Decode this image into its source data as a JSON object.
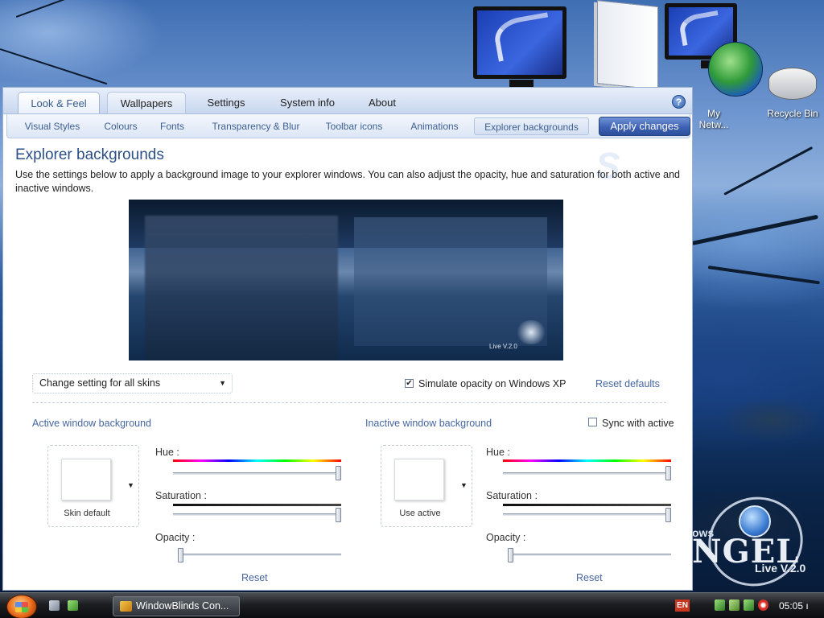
{
  "desktop": {
    "icons": [
      {
        "label": ""
      },
      {
        "label": ""
      },
      {
        "label": "My Netw..."
      },
      {
        "label": "Recycle Bin"
      }
    ],
    "brand": {
      "line1": "ows",
      "line2": "NGEL",
      "version": "Live V.2.0"
    }
  },
  "window": {
    "tabs": [
      {
        "label": "Look & Feel",
        "active": true
      },
      {
        "label": "Wallpapers",
        "active": false
      },
      {
        "label": "Settings",
        "active": false
      },
      {
        "label": "System info",
        "active": false
      },
      {
        "label": "About",
        "active": false
      }
    ],
    "help_label": "?",
    "subtabs": [
      {
        "label": "Visual Styles"
      },
      {
        "label": "Colours"
      },
      {
        "label": "Fonts"
      },
      {
        "label": "Transparency & Blur"
      },
      {
        "label": "Toolbar icons"
      },
      {
        "label": "Animations"
      },
      {
        "label": "Explorer backgrounds",
        "active": true
      }
    ],
    "apply_label": "Apply changes",
    "page_title": "Explorer backgrounds",
    "description": "Use the settings below to apply a background image to your explorer windows.  You can also adjust the opacity, hue and saturation for both active and inactive windows.",
    "preview_version": "Live V.2.0",
    "skin_select": {
      "value": "Change setting for all skins"
    },
    "simulate_opacity": {
      "label": "Simulate opacity on Windows XP",
      "checked": true,
      "mark": "✔"
    },
    "reset_defaults": "Reset defaults",
    "active": {
      "section_label": "Active window background",
      "swatch_caption": "Skin default",
      "hue_label": "Hue :",
      "saturation_label": "Saturation :",
      "opacity_label": "Opacity :",
      "hue": 1.0,
      "saturation": 1.0,
      "opacity": 0.0,
      "reset": "Reset"
    },
    "inactive": {
      "section_label": "Inactive window background",
      "sync_label": "Sync with active",
      "sync_checked": false,
      "swatch_caption": "Use active",
      "hue_label": "Hue :",
      "saturation_label": "Saturation :",
      "opacity_label": "Opacity :",
      "hue": 1.0,
      "saturation": 1.0,
      "opacity": 0.0,
      "reset": "Reset"
    }
  },
  "taskbar": {
    "task_label": "WindowBlinds Con...",
    "language": "EN",
    "clock": "05:05 ı"
  },
  "colors": {
    "accent": "#4566a0",
    "title": "#2b4f86",
    "apply_button": "#3e62b3"
  }
}
